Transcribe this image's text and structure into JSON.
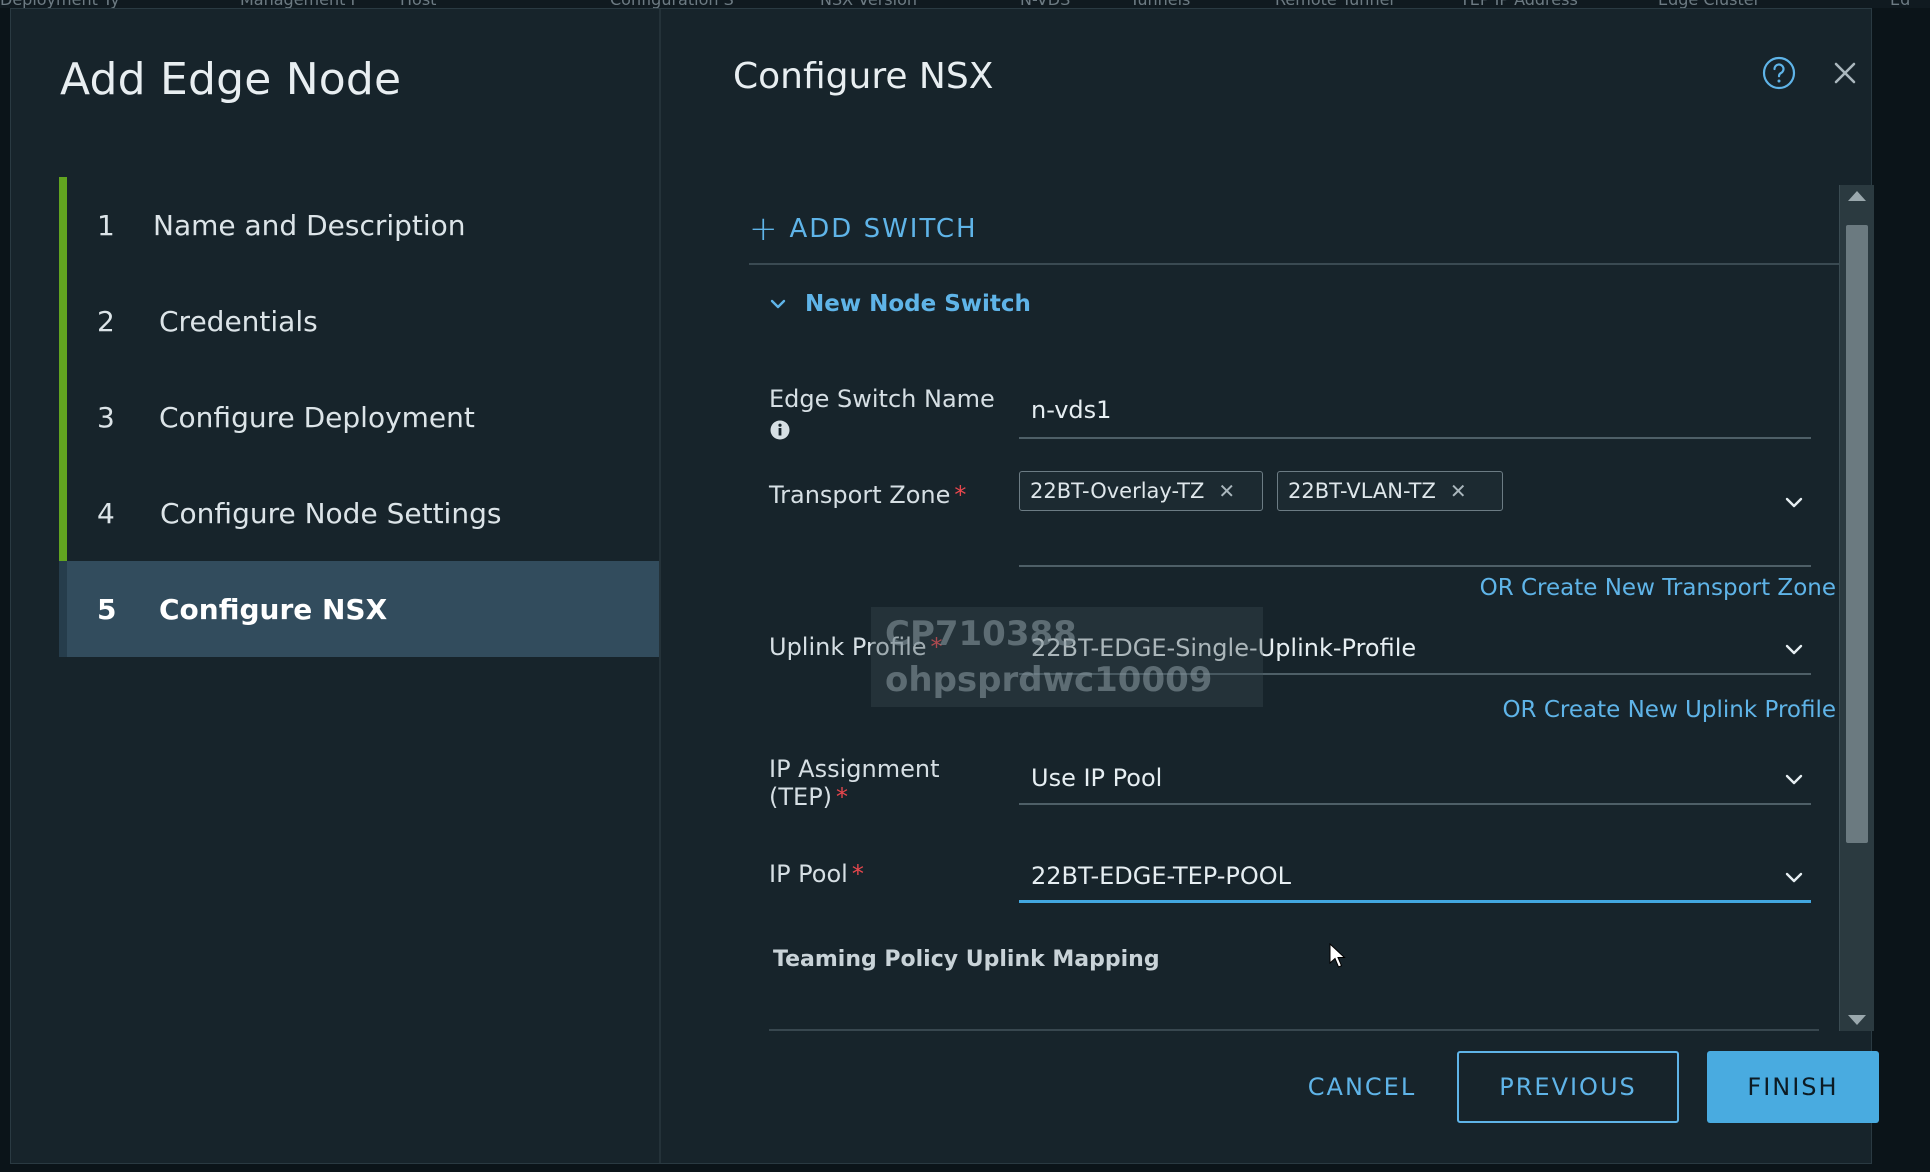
{
  "wizard": {
    "title": "Add Edge Node",
    "steps": [
      {
        "num": "1",
        "label": "Name and Description"
      },
      {
        "num": "2",
        "label": "Credentials"
      },
      {
        "num": "3",
        "label": "Configure Deployment"
      },
      {
        "num": "4",
        "label": "Configure Node Settings"
      },
      {
        "num": "5",
        "label": "Configure NSX"
      }
    ],
    "active_step": 5
  },
  "page": {
    "title": "Configure NSX",
    "add_switch_label": "ADD SWITCH",
    "node_switch_label": "New Node Switch"
  },
  "form": {
    "edge_switch_name": {
      "label": "Edge Switch Name",
      "value": "n-vds1"
    },
    "transport_zone": {
      "label": "Transport Zone",
      "tags": [
        "22BT-Overlay-TZ",
        "22BT-VLAN-TZ"
      ],
      "create_link": "OR Create New Transport Zone"
    },
    "uplink_profile": {
      "label": "Uplink Profile",
      "value": "22BT-EDGE-Single-Uplink-Profile",
      "create_link": "OR Create New Uplink Profile"
    },
    "ip_assignment": {
      "label_line1": "IP Assignment",
      "label_line2": "(TEP)",
      "value": "Use IP Pool"
    },
    "ip_pool": {
      "label": "IP Pool",
      "value": "22BT-EDGE-TEP-POOL"
    },
    "teaming_heading": "Teaming Policy Uplink Mapping"
  },
  "watermark": {
    "line1": "CP710388",
    "line2": "ohpsprdwc10009"
  },
  "footer": {
    "cancel": "CANCEL",
    "previous": "PREVIOUS",
    "finish": "FINISH"
  },
  "colors": {
    "accent": "#49abe0",
    "step_done": "#62a420",
    "required": "#e8474d"
  },
  "background_strip": [
    "Deployment Ty",
    "Management I",
    "Host",
    "Configuration S",
    "NSX Version",
    "N-VDS",
    "Tunnels",
    "Remote Tunnel",
    "TEP IP Address",
    "Edge Cluster",
    "Ed"
  ]
}
